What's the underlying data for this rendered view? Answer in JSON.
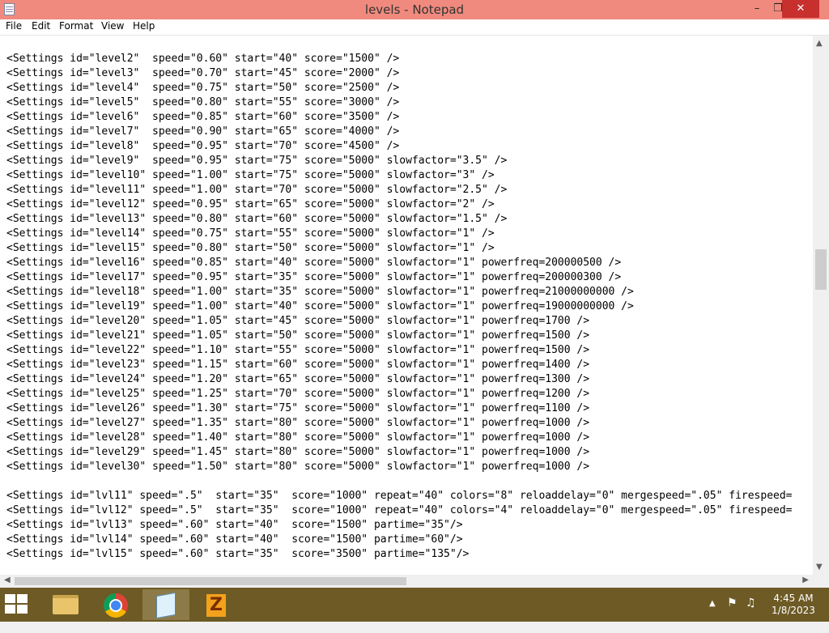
{
  "window": {
    "title": "levels - Notepad",
    "minimize_glyph": "–",
    "maximize_glyph": "❐",
    "close_glyph": "✕"
  },
  "menu": [
    "File",
    "Edit",
    "Format",
    "View",
    "Help"
  ],
  "editor": {
    "lines": [
      "<Settings id=\"level2\"  speed=\"0.60\" start=\"40\" score=\"1500\" />",
      "<Settings id=\"level3\"  speed=\"0.70\" start=\"45\" score=\"2000\" />",
      "<Settings id=\"level4\"  speed=\"0.75\" start=\"50\" score=\"2500\" />",
      "<Settings id=\"level5\"  speed=\"0.80\" start=\"55\" score=\"3000\" />",
      "<Settings id=\"level6\"  speed=\"0.85\" start=\"60\" score=\"3500\" />",
      "<Settings id=\"level7\"  speed=\"0.90\" start=\"65\" score=\"4000\" />",
      "<Settings id=\"level8\"  speed=\"0.95\" start=\"70\" score=\"4500\" />",
      "<Settings id=\"level9\"  speed=\"0.95\" start=\"75\" score=\"5000\" slowfactor=\"3.5\" />",
      "<Settings id=\"level10\" speed=\"1.00\" start=\"75\" score=\"5000\" slowfactor=\"3\" />",
      "<Settings id=\"level11\" speed=\"1.00\" start=\"70\" score=\"5000\" slowfactor=\"2.5\" />",
      "<Settings id=\"level12\" speed=\"0.95\" start=\"65\" score=\"5000\" slowfactor=\"2\" />",
      "<Settings id=\"level13\" speed=\"0.80\" start=\"60\" score=\"5000\" slowfactor=\"1.5\" />",
      "<Settings id=\"level14\" speed=\"0.75\" start=\"55\" score=\"5000\" slowfactor=\"1\" />",
      "<Settings id=\"level15\" speed=\"0.80\" start=\"50\" score=\"5000\" slowfactor=\"1\" />",
      "<Settings id=\"level16\" speed=\"0.85\" start=\"40\" score=\"5000\" slowfactor=\"1\" powerfreq=200000500 />",
      "<Settings id=\"level17\" speed=\"0.95\" start=\"35\" score=\"5000\" slowfactor=\"1\" powerfreq=200000300 />",
      "<Settings id=\"level18\" speed=\"1.00\" start=\"35\" score=\"5000\" slowfactor=\"1\" powerfreq=21000000000 />",
      "<Settings id=\"level19\" speed=\"1.00\" start=\"40\" score=\"5000\" slowfactor=\"1\" powerfreq=19000000000 />",
      "<Settings id=\"level20\" speed=\"1.05\" start=\"45\" score=\"5000\" slowfactor=\"1\" powerfreq=1700 />",
      "<Settings id=\"level21\" speed=\"1.05\" start=\"50\" score=\"5000\" slowfactor=\"1\" powerfreq=1500 />",
      "<Settings id=\"level22\" speed=\"1.10\" start=\"55\" score=\"5000\" slowfactor=\"1\" powerfreq=1500 />",
      "<Settings id=\"level23\" speed=\"1.15\" start=\"60\" score=\"5000\" slowfactor=\"1\" powerfreq=1400 />",
      "<Settings id=\"level24\" speed=\"1.20\" start=\"65\" score=\"5000\" slowfactor=\"1\" powerfreq=1300 />",
      "<Settings id=\"level25\" speed=\"1.25\" start=\"70\" score=\"5000\" slowfactor=\"1\" powerfreq=1200 />",
      "<Settings id=\"level26\" speed=\"1.30\" start=\"75\" score=\"5000\" slowfactor=\"1\" powerfreq=1100 />",
      "<Settings id=\"level27\" speed=\"1.35\" start=\"80\" score=\"5000\" slowfactor=\"1\" powerfreq=1000 />",
      "<Settings id=\"level28\" speed=\"1.40\" start=\"80\" score=\"5000\" slowfactor=\"1\" powerfreq=1000 />",
      "<Settings id=\"level29\" speed=\"1.45\" start=\"80\" score=\"5000\" slowfactor=\"1\" powerfreq=1000 />",
      "<Settings id=\"level30\" speed=\"1.50\" start=\"80\" score=\"5000\" slowfactor=\"1\" powerfreq=1000 />",
      "",
      "<Settings id=\"lvl11\" speed=\".5\"  start=\"35\"  score=\"1000\" repeat=\"40\" colors=\"8\" reloaddelay=\"0\" mergespeed=\".05\" firespeed=",
      "<Settings id=\"lvl12\" speed=\".5\"  start=\"35\"  score=\"1000\" repeat=\"40\" colors=\"4\" reloaddelay=\"0\" mergespeed=\".05\" firespeed=",
      "<Settings id=\"lvl13\" speed=\".60\" start=\"40\"  score=\"1500\" partime=\"35\"/>",
      "<Settings id=\"lvl14\" speed=\".60\" start=\"40\"  score=\"1500\" partime=\"60\"/>",
      "<Settings id=\"lvl15\" speed=\".60\" start=\"35\"  score=\"3500\" partime=\"135\"/>"
    ]
  },
  "scrollbars": {
    "up": "▲",
    "down": "▼",
    "left": "◀",
    "right": "▶"
  },
  "taskbar": {
    "apps": [
      "start-icon",
      "file-explorer-icon",
      "chrome-icon",
      "notepad-icon",
      "app-z-icon"
    ],
    "z_letter": "Z",
    "tray": {
      "chevron": "▲",
      "flag": "⚑",
      "speaker": "♫"
    },
    "clock": {
      "time": "4:45 AM",
      "date": "1/8/2023"
    }
  },
  "colors": {
    "titlebar": "#f08a7e",
    "close_button": "#c7302d",
    "taskbar": "#6d5a25"
  }
}
